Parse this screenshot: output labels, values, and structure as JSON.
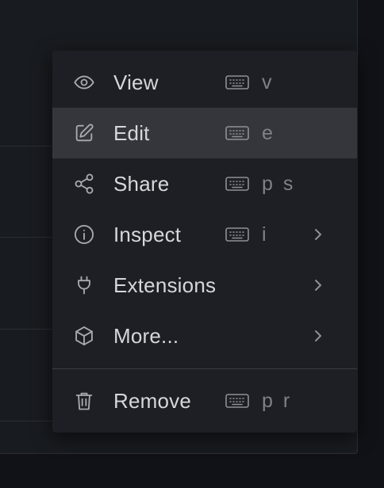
{
  "menu": {
    "items": [
      {
        "label": "View",
        "icon": "eye-icon",
        "shortcut": "v",
        "has_submenu": false
      },
      {
        "label": "Edit",
        "icon": "pencil-square-icon",
        "shortcut": "e",
        "has_submenu": false,
        "active": true
      },
      {
        "label": "Share",
        "icon": "share-icon",
        "shortcut": "p s",
        "has_submenu": false
      },
      {
        "label": "Inspect",
        "icon": "info-circle-icon",
        "shortcut": "i",
        "has_submenu": true
      },
      {
        "label": "Extensions",
        "icon": "plug-icon",
        "shortcut": "",
        "has_submenu": true
      },
      {
        "label": "More...",
        "icon": "cube-icon",
        "shortcut": "",
        "has_submenu": true
      },
      {
        "label": "Remove",
        "icon": "trash-icon",
        "shortcut": "p r",
        "has_submenu": false
      }
    ],
    "shortcut_icon": "keyboard-icon",
    "submenu_icon": "chevron-right-icon"
  },
  "colors": {
    "background": "#111217",
    "menu_background": "#1d1f24",
    "active_background": "#34363b",
    "text": "#d6d7da",
    "muted_text": "#7f8187"
  }
}
